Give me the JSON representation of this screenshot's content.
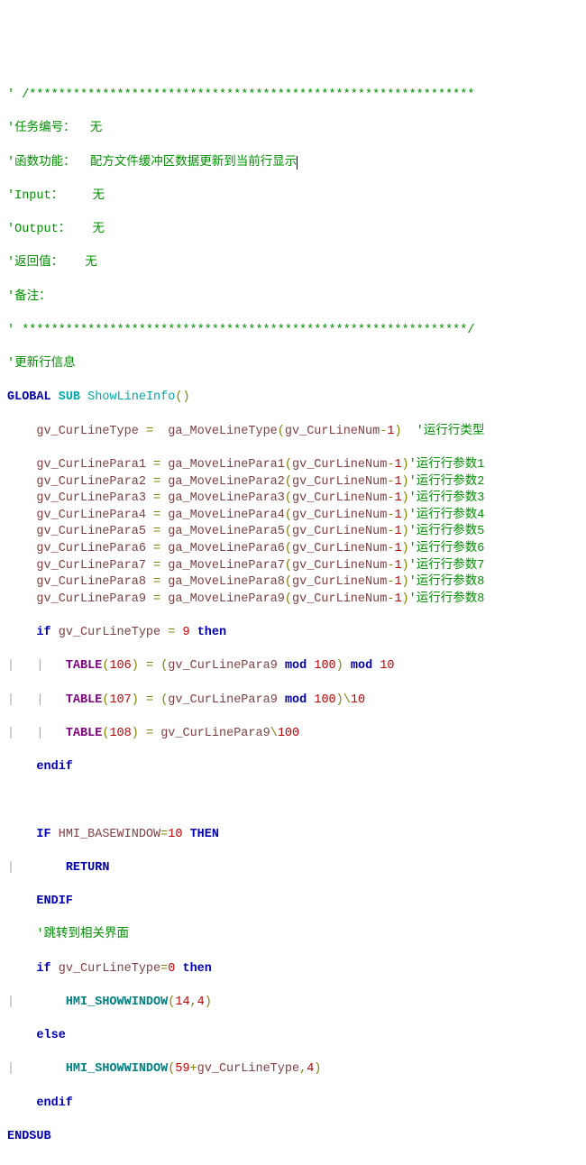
{
  "header": {
    "sep1": "' /*************************************************************",
    "l1": "'任务编号：  无",
    "l2_pre": "'函数功能：  配方文件缓冲区数据更新到当前行显示",
    "l3": "'Input：    无",
    "l4": "'Output：   无",
    "l5": "'返回值：   无",
    "l6": "'备注：",
    "sep2": "' *************************************************************/",
    "l7": "'更新行信息"
  },
  "sub": {
    "global": "GLOBAL",
    "subkw": "SUB",
    "name": "ShowLineInfo",
    "endsub": "ENDSUB"
  },
  "assign": {
    "at": {
      "lhs": "gv_CurLineType",
      "rhs": "ga_MoveLineType",
      "arg": "gv_CurLineNum",
      "cmt": "'运行行类型"
    },
    "rows": [
      {
        "lhs": "gv_CurLinePara1",
        "rhs": "ga_MoveLinePara1",
        "arg": "gv_CurLineNum",
        "cmt": "'运行行参数1"
      },
      {
        "lhs": "gv_CurLinePara2",
        "rhs": "ga_MoveLinePara2",
        "arg": "gv_CurLineNum",
        "cmt": "'运行行参数2"
      },
      {
        "lhs": "gv_CurLinePara3",
        "rhs": "ga_MoveLinePara3",
        "arg": "gv_CurLineNum",
        "cmt": "'运行行参数3"
      },
      {
        "lhs": "gv_CurLinePara4",
        "rhs": "ga_MoveLinePara4",
        "arg": "gv_CurLineNum",
        "cmt": "'运行行参数4"
      },
      {
        "lhs": "gv_CurLinePara5",
        "rhs": "ga_MoveLinePara5",
        "arg": "gv_CurLineNum",
        "cmt": "'运行行参数5"
      },
      {
        "lhs": "gv_CurLinePara6",
        "rhs": "ga_MoveLinePara6",
        "arg": "gv_CurLineNum",
        "cmt": "'运行行参数6"
      },
      {
        "lhs": "gv_CurLinePara7",
        "rhs": "ga_MoveLinePara7",
        "arg": "gv_CurLineNum",
        "cmt": "'运行行参数7"
      },
      {
        "lhs": "gv_CurLinePara8",
        "rhs": "ga_MoveLinePara8",
        "arg": "gv_CurLineNum",
        "cmt": "'运行行参数8"
      },
      {
        "lhs": "gv_CurLinePara9",
        "rhs": "ga_MoveLinePara9",
        "arg": "gv_CurLineNum",
        "cmt": "'运行行参数8"
      }
    ]
  },
  "kw": {
    "if": "if",
    "then": "then",
    "endif": "endif",
    "else": "else",
    "IF": "IF",
    "THEN": "THEN",
    "ENDIF": "ENDIF",
    "RETURN": "RETURN",
    "mod": "mod"
  },
  "ifblock": {
    "ifvar": "gv_CurLineType",
    "eqval": "9",
    "tablekw": "TABLE",
    "t1": {
      "idx": "106",
      "expr_a": "gv_CurLinePara9",
      "hundred": "100",
      "ten": "10"
    },
    "t2": {
      "idx": "107",
      "expr_a": "gv_CurLinePara9",
      "hundred": "100",
      "ten": "10"
    },
    "t3": {
      "idx": "108",
      "expr_a": "gv_CurLinePara9",
      "hundred": "100"
    }
  },
  "hmibase": {
    "var": "HMI_BASEWINDOW",
    "ten": "10"
  },
  "gotocmt": "'跳转到相关界面",
  "if2": {
    "var": "gv_CurLineType",
    "zero": "0",
    "showfn": "HMI_SHOWWINDOW",
    "a1": "14",
    "a2": "4",
    "b_offset": "59",
    "b_var": "gv_CurLineType",
    "b2": "4"
  },
  "num": {
    "minus1": "1"
  },
  "indent1": "    ",
  "indent2": "|   |   ",
  "indent3": "|   ",
  "indent2b": "        "
}
